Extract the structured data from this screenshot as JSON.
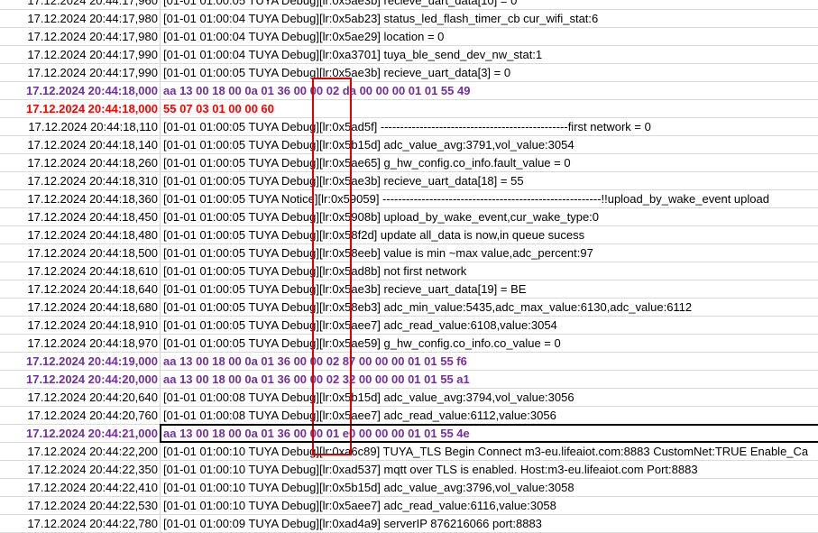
{
  "log_rows": [
    {
      "timestamp": "17.12.2024 20:44:17,960",
      "message": "[01-01 01:00:05 TUYA Debug][lr:0x5ae3b] recieve_uart_data[10] = 0",
      "style": "normal"
    },
    {
      "timestamp": "17.12.2024 20:44:17,980",
      "message": "[01-01 01:00:04 TUYA Debug][lr:0x5ab23] status_led_flash_timer_cb cur_wifi_stat:6",
      "style": "normal"
    },
    {
      "timestamp": "17.12.2024 20:44:17,980",
      "message": "[01-01 01:00:04 TUYA Debug][lr:0x5ae29] location = 0",
      "style": "normal"
    },
    {
      "timestamp": "17.12.2024 20:44:17,990",
      "message": "[01-01 01:00:04 TUYA Debug][lr:0xa3701] tuya_ble_send_dev_nw_stat:1",
      "style": "normal"
    },
    {
      "timestamp": "17.12.2024 20:44:17,990",
      "message": "[01-01 01:00:05 TUYA Debug][lr:0x5ae3b] recieve_uart_data[3] = 0",
      "style": "normal"
    },
    {
      "timestamp": "17.12.2024 20:44:18,000",
      "message": "aa 13 00 18 00 0a 01 36 00 00 02 da 00 00 00 01 01 55 49",
      "style": "purple"
    },
    {
      "timestamp": "17.12.2024 20:44:18,000",
      "message": "55 07 03 01 00 00 60",
      "style": "red"
    },
    {
      "timestamp": "17.12.2024 20:44:18,110",
      "message": "[01-01 01:00:05 TUYA Debug][lr:0x5ad5f] ------------------------------------------------first network = 0",
      "style": "normal"
    },
    {
      "timestamp": "17.12.2024 20:44:18,140",
      "message": "[01-01 01:00:05 TUYA Debug][lr:0x5b15d] adc_value_avg:3791,vol_value:3054",
      "style": "normal"
    },
    {
      "timestamp": "17.12.2024 20:44:18,260",
      "message": "[01-01 01:00:05 TUYA Debug][lr:0x5ae65] g_hw_config.co_info.fault_value = 0",
      "style": "normal"
    },
    {
      "timestamp": "17.12.2024 20:44:18,310",
      "message": "[01-01 01:00:05 TUYA Debug][lr:0x5ae3b] recieve_uart_data[18] = 55",
      "style": "normal"
    },
    {
      "timestamp": "17.12.2024 20:44:18,360",
      "message": "[01-01 01:00:05 TUYA Notice][lr:0x59059] --------------------------------------------------------!!upload_by_wake_event upload",
      "style": "normal"
    },
    {
      "timestamp": "17.12.2024 20:44:18,450",
      "message": "[01-01 01:00:05 TUYA Debug][lr:0x5908b] upload_by_wake_event,cur_wake_type:0",
      "style": "normal"
    },
    {
      "timestamp": "17.12.2024 20:44:18,480",
      "message": "[01-01 01:00:05 TUYA Debug][lr:0x58f2d] update all_data is now,in queue sucess",
      "style": "normal"
    },
    {
      "timestamp": "17.12.2024 20:44:18,500",
      "message": "[01-01 01:00:05 TUYA Debug][lr:0x58eeb] value is min ~max value,adc_percent:97",
      "style": "normal"
    },
    {
      "timestamp": "17.12.2024 20:44:18,610",
      "message": "[01-01 01:00:05 TUYA Debug][lr:0x5ad8b] not first network",
      "style": "normal"
    },
    {
      "timestamp": "17.12.2024 20:44:18,640",
      "message": "[01-01 01:00:05 TUYA Debug][lr:0x5ae3b] recieve_uart_data[19] = BE",
      "style": "normal"
    },
    {
      "timestamp": "17.12.2024 20:44:18,680",
      "message": "[01-01 01:00:05 TUYA Debug][lr:0x58eb3] adc_min_value:5435,adc_max_value:6130,adc_value:6112",
      "style": "normal"
    },
    {
      "timestamp": "17.12.2024 20:44:18,910",
      "message": "[01-01 01:00:05 TUYA Debug][lr:0x5aee7] adc_read_value:6108,value:3054",
      "style": "normal"
    },
    {
      "timestamp": "17.12.2024 20:44:18,970",
      "message": "[01-01 01:00:05 TUYA Debug][lr:0x5ae59] g_hw_config.co_info.co_value = 0",
      "style": "normal"
    },
    {
      "timestamp": "17.12.2024 20:44:19,000",
      "message": "aa 13 00 18 00 0a 01 36 00 00 02 87 00 00 00 01 01 55 f6",
      "style": "purple"
    },
    {
      "timestamp": "17.12.2024 20:44:20,000",
      "message": "aa 13 00 18 00 0a 01 36 00 00 02 32 00 00 00 01 01 55 a1",
      "style": "purple"
    },
    {
      "timestamp": "17.12.2024 20:44:20,640",
      "message": "[01-01 01:00:08 TUYA Debug][lr:0x5b15d] adc_value_avg:3794,vol_value:3056",
      "style": "normal"
    },
    {
      "timestamp": "17.12.2024 20:44:20,760",
      "message": "[01-01 01:00:08 TUYA Debug][lr:0x5aee7] adc_read_value:6112,value:3056",
      "style": "normal"
    },
    {
      "timestamp": "17.12.2024 20:44:21,000",
      "message": "aa 13 00 18 00 0a 01 36 00 00 01 e0 00 00 00 01 01 55 4e",
      "style": "purple"
    },
    {
      "timestamp": "17.12.2024 20:44:22,200",
      "message": "[01-01 01:00:10 TUYA Debug][lr:0xa6c89] TUYA_TLS Begin Connect m3-eu.lifeaiot.com:8883  CustomNet:TRUE Enable_Ca",
      "style": "normal"
    },
    {
      "timestamp": "17.12.2024 20:44:22,350",
      "message": "[01-01 01:00:10 TUYA Debug][lr:0xad537] mqtt over TLS is enabled. Host:m3-eu.lifeaiot.com Port:8883",
      "style": "normal"
    },
    {
      "timestamp": "17.12.2024 20:44:22,410",
      "message": "[01-01 01:00:10 TUYA Debug][lr:0x5b15d] adc_value_avg:3796,vol_value:3058",
      "style": "normal"
    },
    {
      "timestamp": "17.12.2024 20:44:22,530",
      "message": "[01-01 01:00:10 TUYA Debug][lr:0x5aee7] adc_read_value:6116,value:3058",
      "style": "normal"
    },
    {
      "timestamp": "17.12.2024 20:44:22,780",
      "message": "[01-01 01:00:09 TUYA Debug][lr:0xad4a9] serverIP 876216066 port:8883",
      "style": "normal"
    }
  ],
  "colors": {
    "purple_rows": "#7030a0",
    "red_rows": "#ff0000",
    "highlight_column": "#e00000",
    "highlight_row": "#000000"
  }
}
